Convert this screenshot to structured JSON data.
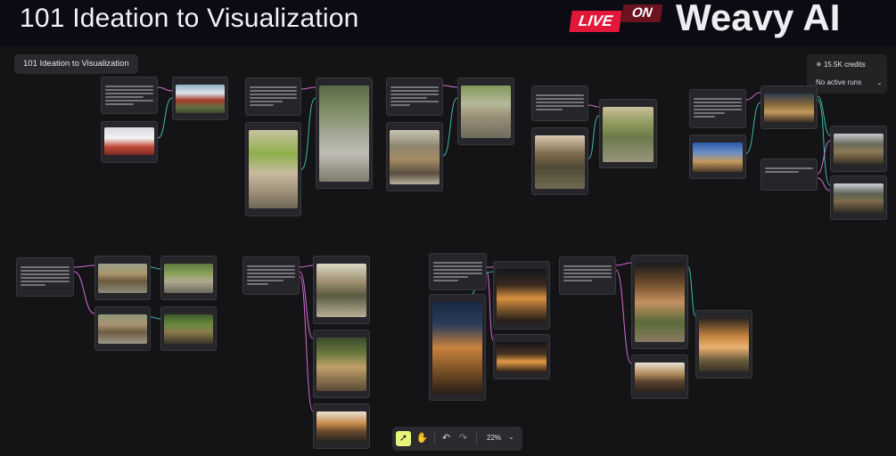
{
  "banner": {
    "title": "101 Ideation to Visualization",
    "live_label": "LIVE",
    "on_label": "ON",
    "brand": "Weavy AI"
  },
  "canvas": {
    "workflow_name": "101 Ideation to Visualization",
    "credits": "15.5K credits",
    "runs_status": "No active runs",
    "colors": {
      "background": "#141416",
      "node": "#26262a",
      "wire_teal": "#3fb7a8",
      "wire_pink": "#d26bd6",
      "accent": "#e9f57a"
    }
  },
  "toolbar": {
    "select_icon": "cursor-select-icon",
    "pan_icon": "hand-pan-icon",
    "undo_icon": "undo-icon",
    "redo_icon": "redo-icon",
    "zoom": "22%"
  }
}
